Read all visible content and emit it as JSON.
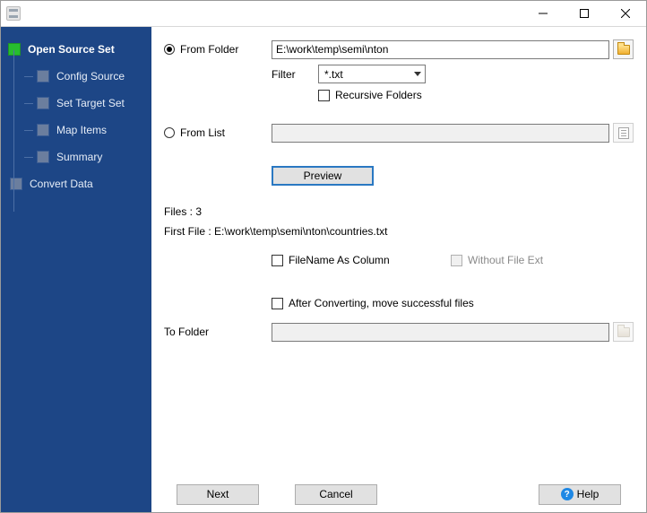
{
  "window": {
    "title": ""
  },
  "sidebar": {
    "items": [
      {
        "label": "Open Source Set",
        "type": "root"
      },
      {
        "label": "Config Source",
        "type": "child"
      },
      {
        "label": "Set Target Set",
        "type": "child"
      },
      {
        "label": "Map Items",
        "type": "child"
      },
      {
        "label": "Summary",
        "type": "child"
      },
      {
        "label": "Convert Data",
        "type": "level1"
      }
    ]
  },
  "form": {
    "fromFolder": {
      "label": "From Folder",
      "value": "E:\\work\\temp\\semi\\nton",
      "checked": true
    },
    "filter": {
      "label": "Filter",
      "value": "*.txt"
    },
    "recursive": {
      "label": "Recursive Folders",
      "checked": false
    },
    "fromList": {
      "label": "From List",
      "value": "",
      "checked": false
    },
    "previewLabel": "Preview",
    "filesLine": "Files : 3",
    "firstFileLine": "First File : E:\\work\\temp\\semi\\nton\\countries.txt",
    "filenameAsColumn": {
      "label": "FileName As Column",
      "checked": false
    },
    "withoutExt": {
      "label": "Without File Ext",
      "checked": false
    },
    "afterConvert": {
      "label": "After Converting, move successful files",
      "checked": false
    },
    "toFolder": {
      "label": "To Folder",
      "value": ""
    }
  },
  "buttons": {
    "next": "Next",
    "cancel": "Cancel",
    "help": "Help"
  }
}
